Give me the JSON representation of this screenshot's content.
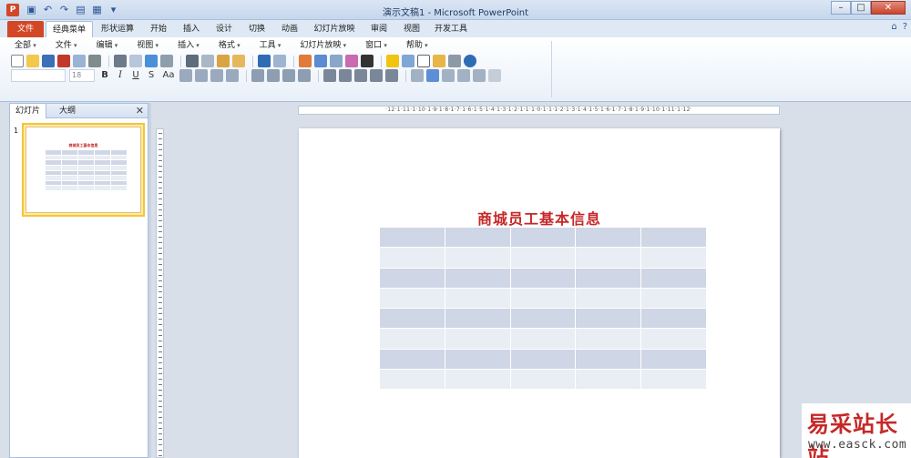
{
  "window": {
    "title": "演示文稿1 - Microsoft PowerPoint",
    "app_icon_letter": "P",
    "controls": {
      "minimize": "–",
      "maximize": "□",
      "close": "✕"
    }
  },
  "qat_icons": [
    "save-icon",
    "undo-icon",
    "redo-icon",
    "layout-icon",
    "slides-icon",
    "customize-qat-icon"
  ],
  "tabs": [
    {
      "label": "文件"
    },
    {
      "label": "经典菜单"
    },
    {
      "label": "形状运算"
    },
    {
      "label": "开始"
    },
    {
      "label": "插入"
    },
    {
      "label": "设计"
    },
    {
      "label": "切换"
    },
    {
      "label": "动画"
    },
    {
      "label": "幻灯片放映"
    },
    {
      "label": "审阅"
    },
    {
      "label": "视图"
    },
    {
      "label": "开发工具"
    }
  ],
  "classic_menu": [
    "全部",
    "文件",
    "编辑",
    "视图",
    "插入",
    "格式",
    "工具",
    "幻灯片放映",
    "窗口",
    "帮助"
  ],
  "font_size": "18",
  "format_buttons": [
    "B",
    "I",
    "U",
    "S",
    "Aa"
  ],
  "panel": {
    "tab_slides": "幻灯片",
    "tab_outline": "大纲",
    "close": "✕",
    "slide_number": "1"
  },
  "ruler_text": "·12·1·11·1·10·1·9·1·8·1·7·1·6·1·5·1·4·1·3·1·2·1·1·1·0·1·1·1·2·1·3·1·4·1·5·1·6·1·7·1·8·1·9·1·10·1·11·1·12·",
  "slide": {
    "title": "商城员工基本信息",
    "table_rows": 8,
    "table_cols": 5
  },
  "colors": {
    "file_tab": "#d24726",
    "title_red": "#c62828",
    "table_dark": "#cfd6e6",
    "table_light": "#e9edf4"
  },
  "watermark": {
    "text": "易采站长站",
    "url": "www.easck.com"
  }
}
